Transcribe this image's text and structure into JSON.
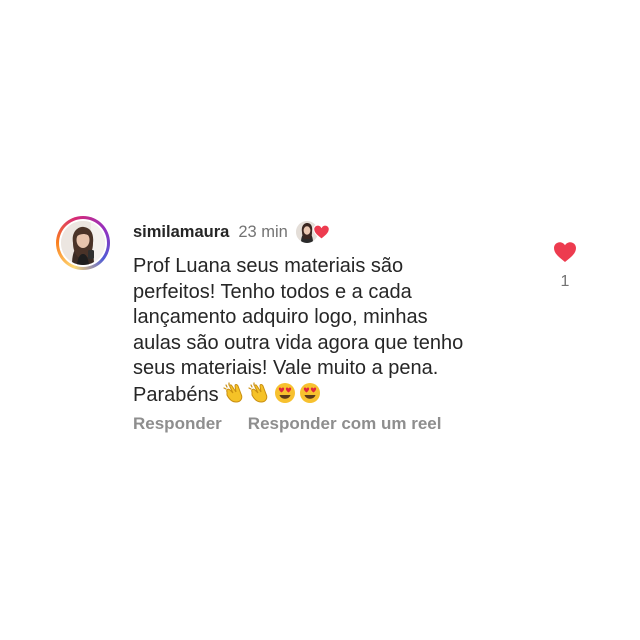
{
  "comment": {
    "username": "similamaura",
    "time": "23 min",
    "text": "Prof Luana seus materiais são\nperfeitos! Tenho todos e a cada\nlançamento adquiro logo, minhas\naulas são outra vida agora que tenho\nseus materiais! Vale muito a pena.\nParabéns",
    "emojis": [
      "clapping-hands-icon",
      "clapping-hands-icon",
      "heart-eyes-face-icon",
      "heart-eyes-face-icon"
    ],
    "like_count": "1",
    "liked": true,
    "liked_by_creator": true
  },
  "actions": {
    "reply_label": "Responder",
    "reply_reel_label": "Responder com um reel"
  },
  "icons": {
    "heart": "heart-icon",
    "avatar": "avatar",
    "creator_like": "creator-liked-badge"
  },
  "colors": {
    "heart_red": "#ed3b4f",
    "text": "#262626",
    "muted": "#737373",
    "action_gray": "#8e8e8e"
  }
}
